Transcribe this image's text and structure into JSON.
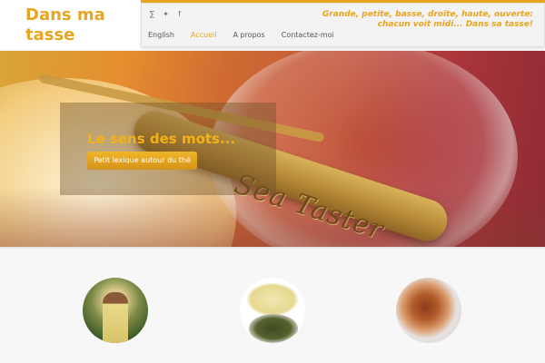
{
  "site": {
    "logo_line1": "Dans ma",
    "logo_line2": "tasse",
    "tagline": "Grande, petite, basse, droite, haute, ouverte: chacun voit midi... Dans sa tasse!"
  },
  "social": [
    {
      "icon": "rss-icon",
      "glyph": "∑"
    },
    {
      "icon": "twitter-icon",
      "glyph": "✦"
    },
    {
      "icon": "facebook-icon",
      "glyph": "f"
    }
  ],
  "nav": {
    "items": [
      {
        "label": "English",
        "active": false
      },
      {
        "label": "Accueil",
        "active": true
      },
      {
        "label": "A propos",
        "active": false
      },
      {
        "label": "Contactez-moi",
        "active": false
      }
    ]
  },
  "hero": {
    "title": "Le sens des mots...",
    "button_label": "Petit lexique autour du thé",
    "spoon_engraving": "Sea Taster"
  },
  "colors": {
    "accent": "#e8a520",
    "nav_text": "#555555"
  }
}
